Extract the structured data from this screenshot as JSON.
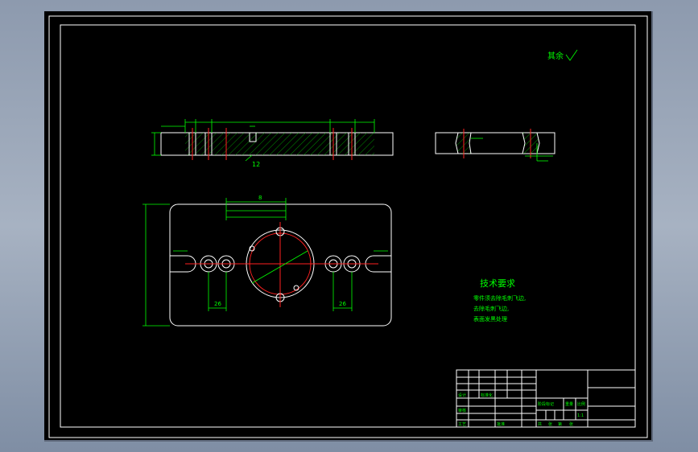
{
  "drawing": {
    "surface_note": "其余",
    "labels": {
      "section_depth": "12",
      "pitch_dim_1": "26",
      "pitch_dim_2": "26",
      "dim_top": "8"
    },
    "tech_requirements": {
      "title": "技术要求",
      "lines": [
        "零件须去除毛刺飞边,",
        "去除毛刺飞边,",
        "表面发黑处理"
      ]
    },
    "title_block": {
      "cells": [
        "设计",
        "标准化",
        "审核",
        "工艺",
        "批准",
        "阶段标记",
        "重量",
        "比例",
        "共",
        "张",
        "第",
        "张",
        "1:1"
      ]
    }
  },
  "colors": {
    "geometry": "#ffffff",
    "dimension": "#00ff00",
    "centerline": "#ff2020",
    "background": "#000000"
  }
}
